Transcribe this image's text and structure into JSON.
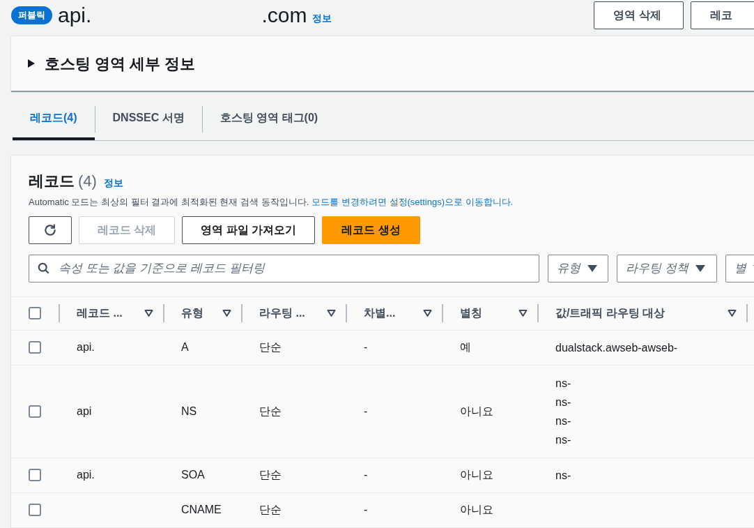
{
  "header": {
    "badge": "퍼블릭",
    "title_start": "api.",
    "title_end": ".com",
    "info_link": "정보",
    "buttons": [
      {
        "label": "영역 삭제"
      },
      {
        "label": "레코"
      }
    ]
  },
  "details": {
    "title": "호스팅 영역 세부 정보",
    "expanded": false
  },
  "tabs": [
    {
      "label": "레코드(4)",
      "selected": true
    },
    {
      "label": "DNSSEC 서명",
      "selected": false
    },
    {
      "label": "호스팅 영역 태그(0)",
      "selected": false
    }
  ],
  "records": {
    "title": "레코드",
    "count": "(4)",
    "info_link": "정보",
    "description": "Automatic 모드는 최상의 필터 결과에 최적화된 현재 검색 동작입니다.",
    "settings_link": "모드를 변경하려면 설정(settings)으로 이동합니다.",
    "actions": [
      {
        "kind": "refresh",
        "disabled": false
      },
      {
        "kind": "normal",
        "label": "레코드 삭제",
        "disabled": true
      },
      {
        "kind": "normal",
        "label": "영역 파일 가져오기",
        "disabled": false
      },
      {
        "kind": "primary",
        "label": "레코드 생성",
        "disabled": false
      }
    ],
    "search": {
      "placeholder": "속성 또는 값을 기준으로 레코드 필터링"
    },
    "filters": [
      {
        "placeholder": "유형"
      },
      {
        "placeholder": "라우팅 정책"
      },
      {
        "placeholder": "별"
      }
    ],
    "select_all_checked": false,
    "columns": [
      "레코드 ...",
      "유형",
      "라우팅 ...",
      "차별...",
      "별칭",
      "값/트래픽 라우팅 대상"
    ],
    "rows": [
      {
        "checked": false,
        "cells": [
          "api.",
          "A",
          "단순",
          "-",
          "예"
        ],
        "values": [
          "dualstack.awseb-awseb-"
        ]
      },
      {
        "checked": false,
        "cells": [
          "api",
          "NS",
          "단순",
          "-",
          "아니요"
        ],
        "values": [
          "ns-",
          "ns-",
          "ns-",
          "ns-"
        ]
      },
      {
        "checked": false,
        "cells": [
          "api.",
          "SOA",
          "단순",
          "-",
          "아니요"
        ],
        "values": [
          "ns-"
        ]
      },
      {
        "checked": false,
        "cells": [
          "",
          "CNAME",
          "단순",
          "-",
          "아니요"
        ],
        "values": []
      }
    ]
  }
}
